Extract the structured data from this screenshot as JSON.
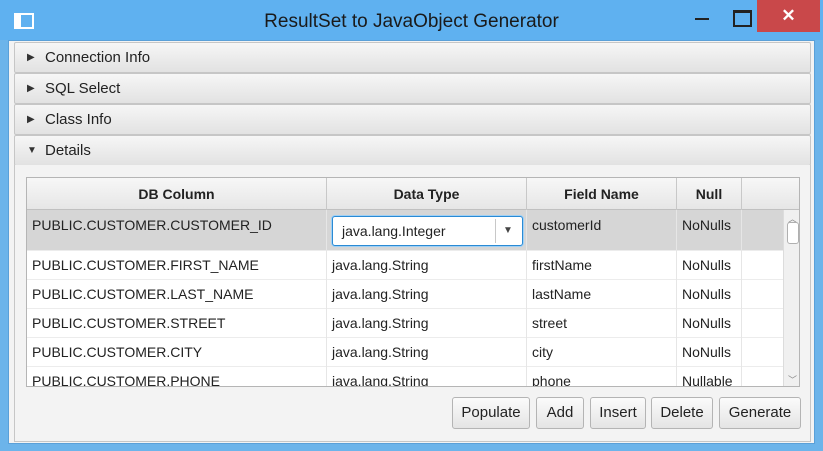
{
  "window": {
    "title": "ResultSet to JavaObject Generator",
    "close_glyph": "✕",
    "icons": {
      "app": "app-window-icon",
      "minimize": "minimize-icon",
      "maximize": "maximize-icon",
      "close": "close-icon"
    }
  },
  "panes": [
    {
      "label": "Connection Info",
      "expanded": false
    },
    {
      "label": "SQL Select",
      "expanded": false
    },
    {
      "label": "Class Info",
      "expanded": false
    },
    {
      "label": "Details",
      "expanded": true
    }
  ],
  "table": {
    "columns": [
      "DB Column",
      "Data Type",
      "Field Name",
      "Null"
    ],
    "selected_row": 0,
    "rows": [
      {
        "db_column": "PUBLIC.CUSTOMER.CUSTOMER_ID",
        "data_type": "java.lang.Integer",
        "field_name": "customerId",
        "null": "NoNulls"
      },
      {
        "db_column": "PUBLIC.CUSTOMER.FIRST_NAME",
        "data_type": "java.lang.String",
        "field_name": "firstName",
        "null": "NoNulls"
      },
      {
        "db_column": "PUBLIC.CUSTOMER.LAST_NAME",
        "data_type": "java.lang.String",
        "field_name": "lastName",
        "null": "NoNulls"
      },
      {
        "db_column": "PUBLIC.CUSTOMER.STREET",
        "data_type": "java.lang.String",
        "field_name": "street",
        "null": "NoNulls"
      },
      {
        "db_column": "PUBLIC.CUSTOMER.CITY",
        "data_type": "java.lang.String",
        "field_name": "city",
        "null": "NoNulls"
      },
      {
        "db_column": "PUBLIC.CUSTOMER.PHONE",
        "data_type": "java.lang.String",
        "field_name": "phone",
        "null": "Nullable"
      }
    ]
  },
  "buttons": {
    "populate": "Populate",
    "add": "Add",
    "insert": "Insert",
    "delete": "Delete",
    "generate": "Generate"
  },
  "colors": {
    "title_bar": "#5fb1f0",
    "close_button": "#c9484a",
    "selection_row": "#d6d6d6",
    "focus_border": "#2a8ad4"
  }
}
